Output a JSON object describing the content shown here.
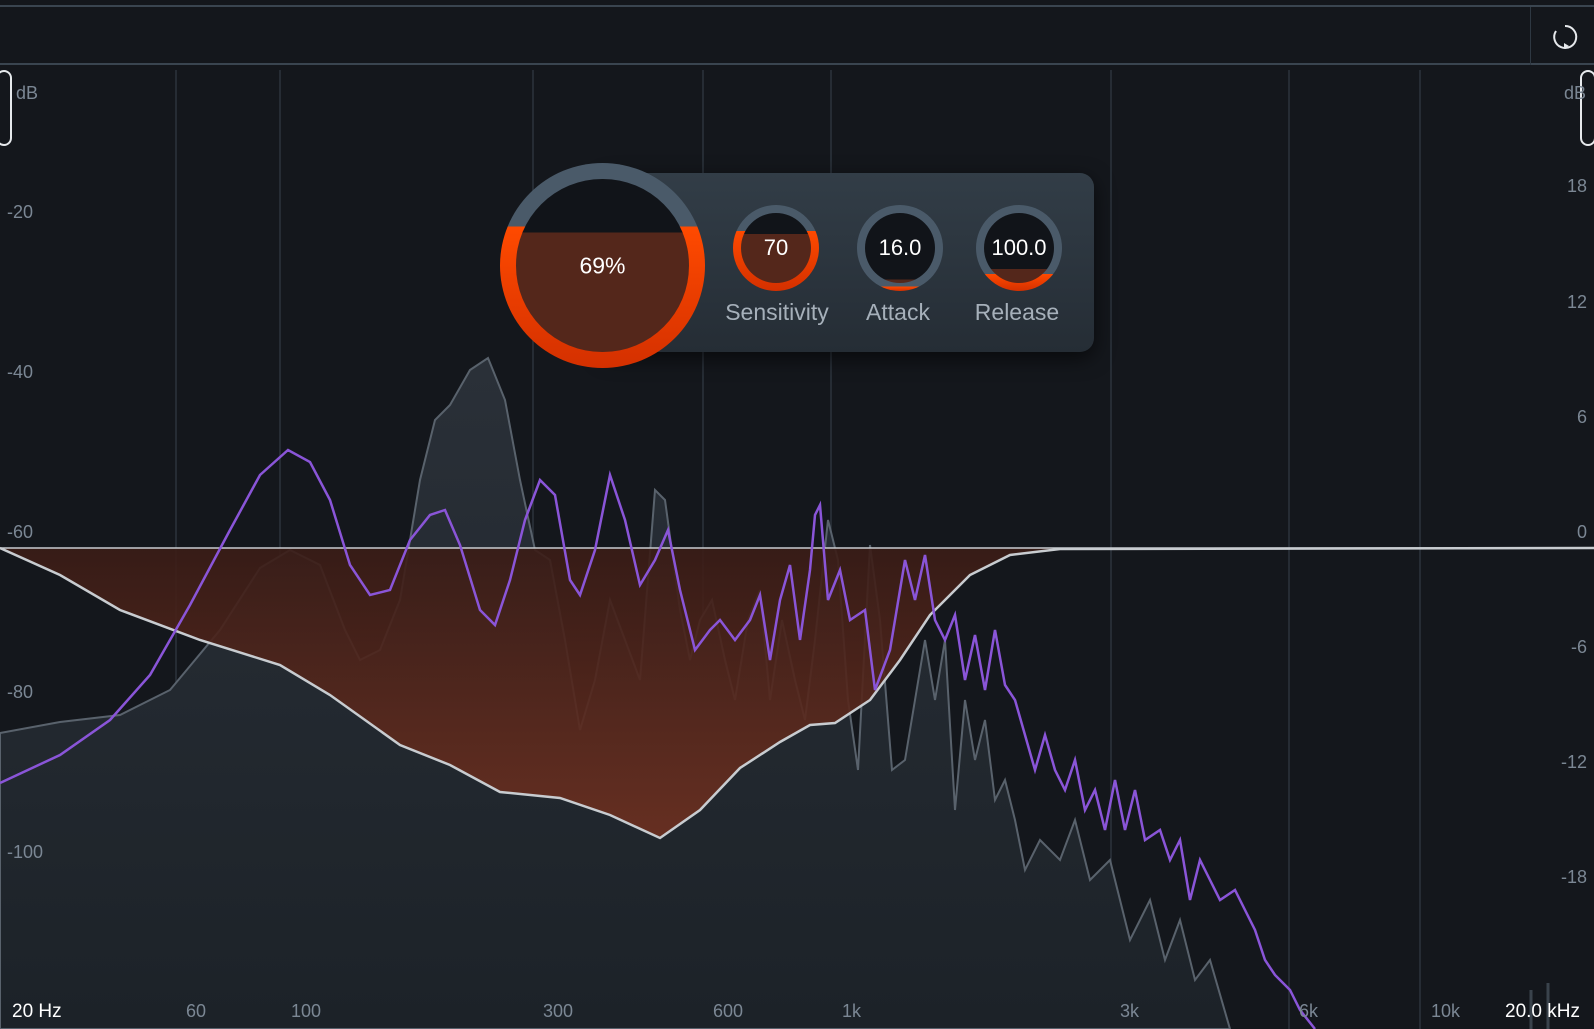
{
  "axis_left": {
    "unit_label": "dB",
    "ticks": [
      "-20",
      "-40",
      "-60",
      "-80",
      "-100"
    ]
  },
  "axis_right": {
    "unit_label": "dB",
    "ticks": [
      "18",
      "12",
      "6",
      "0",
      "-6",
      "-12",
      "-18"
    ]
  },
  "freq_axis": {
    "start": "20 Hz",
    "end": "20.0 kHz",
    "ticks": [
      "60",
      "100",
      "300",
      "600",
      "1k",
      "3k",
      "6k",
      "10k"
    ]
  },
  "controls": {
    "amount": {
      "value": "69%",
      "fill": 0.69
    },
    "sensitivity": {
      "label": "Sensitivity",
      "value": "70",
      "fill": 0.7
    },
    "attack": {
      "label": "Attack",
      "value": "16.0",
      "fill": 0.05
    },
    "release": {
      "label": "Release",
      "value": "100.0",
      "fill": 0.2
    }
  },
  "colors": {
    "accent": "#ff4a00",
    "purple": "#8a55d8",
    "fill": "#5a2818"
  }
}
